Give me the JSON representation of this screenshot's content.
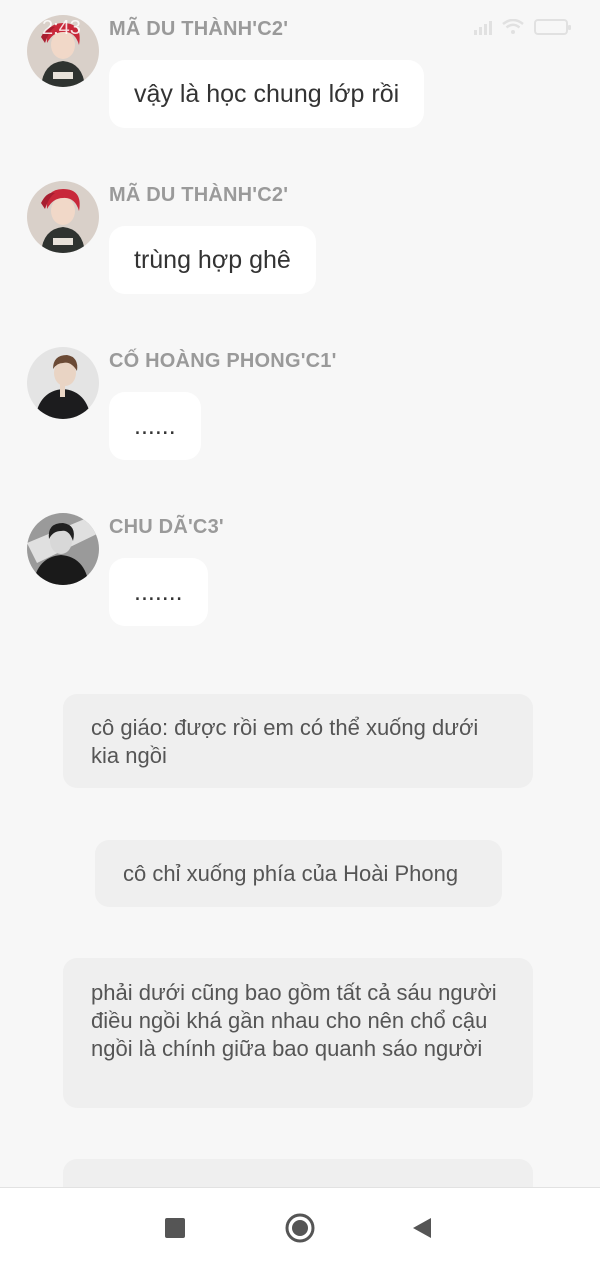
{
  "status_bar": {
    "time": "2:43"
  },
  "messages": [
    {
      "sender": "MÃ DU THÀNH'C2'",
      "text": "vậy là học chung lớp rồi",
      "avatar": "red-hair-avatar"
    },
    {
      "sender": "MÃ DU THÀNH'C2'",
      "text": "trùng hợp ghê",
      "avatar": "red-hair-avatar"
    },
    {
      "sender": "CỐ HOÀNG PHONG'C1'",
      "text": "......",
      "avatar": "dark-suit-avatar"
    },
    {
      "sender": "CHU DÃ'C3'",
      "text": ".......",
      "avatar": "monochrome-avatar"
    }
  ],
  "narrations": [
    "cô giáo: được rồi em có thể xuống dưới kia ngồi",
    "cô chỉ xuống phía của Hoài Phong",
    "phải dưới cũng bao gồm tất cả sáu người điều ngồi khá gần nhau cho nên chổ cậu ngồi là chính giữa bao quanh sáo người"
  ],
  "nav_bar": {
    "recents_icon": "square-icon",
    "home_icon": "circle-icon",
    "back_icon": "triangle-back-icon"
  },
  "colors": {
    "background": "#f7f7f7",
    "bubble": "#ffffff",
    "narration_bg": "#efefef",
    "sender_text": "#9a9a9a",
    "red_hair": "#c8283a"
  }
}
